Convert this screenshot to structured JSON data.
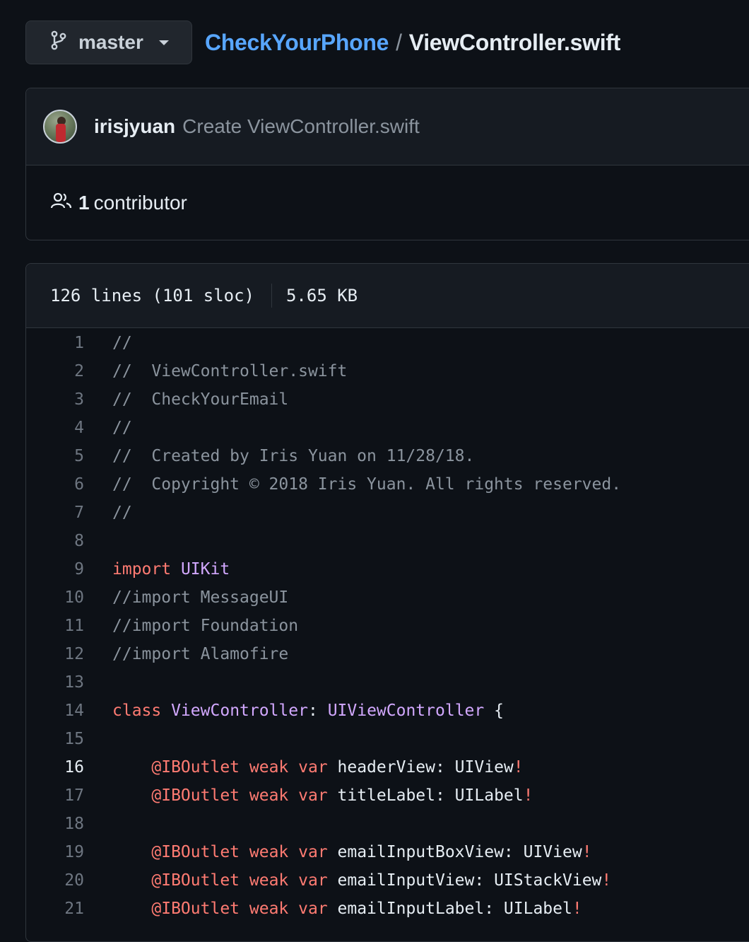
{
  "header": {
    "branch": "master",
    "repo": "CheckYourPhone",
    "separator": "/",
    "file": "ViewController.swift"
  },
  "commit": {
    "author": "irisjyuan",
    "message": "Create ViewController.swift",
    "contributor_count": "1",
    "contributor_label": "contributor"
  },
  "file_info": {
    "lines": "126 lines (101 sloc)",
    "size": "5.65 KB"
  },
  "icons": [
    "git-branch-icon",
    "caret-down-icon",
    "people-icon"
  ],
  "colors": {
    "background": "#0d1117",
    "panel": "#161b22",
    "border": "#30363d",
    "link": "#58a6ff",
    "keyword": "#ff7b72",
    "type": "#d2a8ff",
    "comment": "#8b949e"
  },
  "code": {
    "active_line": 16,
    "lines": [
      {
        "n": "1",
        "segs": [
          {
            "t": "//",
            "c": "cm"
          }
        ]
      },
      {
        "n": "2",
        "segs": [
          {
            "t": "//  ViewController.swift",
            "c": "cm"
          }
        ]
      },
      {
        "n": "3",
        "segs": [
          {
            "t": "//  CheckYourEmail",
            "c": "cm"
          }
        ]
      },
      {
        "n": "4",
        "segs": [
          {
            "t": "//",
            "c": "cm"
          }
        ]
      },
      {
        "n": "5",
        "segs": [
          {
            "t": "//  Created by Iris Yuan on 11/28/18.",
            "c": "cm"
          }
        ]
      },
      {
        "n": "6",
        "segs": [
          {
            "t": "//  Copyright © 2018 Iris Yuan. All rights reserved.",
            "c": "cm"
          }
        ]
      },
      {
        "n": "7",
        "segs": [
          {
            "t": "//",
            "c": "cm"
          }
        ]
      },
      {
        "n": "8",
        "segs": []
      },
      {
        "n": "9",
        "segs": [
          {
            "t": "import",
            "c": "kw"
          },
          {
            "t": " ",
            "c": ""
          },
          {
            "t": "UIKit",
            "c": "ty"
          }
        ]
      },
      {
        "n": "10",
        "segs": [
          {
            "t": "//import MessageUI",
            "c": "cm"
          }
        ]
      },
      {
        "n": "11",
        "segs": [
          {
            "t": "//import Foundation",
            "c": "cm"
          }
        ]
      },
      {
        "n": "12",
        "segs": [
          {
            "t": "//import Alamofire",
            "c": "cm"
          }
        ]
      },
      {
        "n": "13",
        "segs": []
      },
      {
        "n": "14",
        "segs": [
          {
            "t": "class",
            "c": "kw"
          },
          {
            "t": " ",
            "c": ""
          },
          {
            "t": "ViewController",
            "c": "ty"
          },
          {
            "t": ": ",
            "c": ""
          },
          {
            "t": "UIViewController",
            "c": "ty"
          },
          {
            "t": " {",
            "c": ""
          }
        ]
      },
      {
        "n": "15",
        "segs": []
      },
      {
        "n": "16",
        "segs": [
          {
            "t": "    ",
            "c": ""
          },
          {
            "t": "@IBOutlet",
            "c": "kw"
          },
          {
            "t": " ",
            "c": ""
          },
          {
            "t": "weak",
            "c": "kw"
          },
          {
            "t": " ",
            "c": ""
          },
          {
            "t": "var",
            "c": "kw"
          },
          {
            "t": " headerView: UIView",
            "c": ""
          },
          {
            "t": "!",
            "c": "kw"
          }
        ]
      },
      {
        "n": "17",
        "segs": [
          {
            "t": "    ",
            "c": ""
          },
          {
            "t": "@IBOutlet",
            "c": "kw"
          },
          {
            "t": " ",
            "c": ""
          },
          {
            "t": "weak",
            "c": "kw"
          },
          {
            "t": " ",
            "c": ""
          },
          {
            "t": "var",
            "c": "kw"
          },
          {
            "t": " titleLabel: UILabel",
            "c": ""
          },
          {
            "t": "!",
            "c": "kw"
          }
        ]
      },
      {
        "n": "18",
        "segs": []
      },
      {
        "n": "19",
        "segs": [
          {
            "t": "    ",
            "c": ""
          },
          {
            "t": "@IBOutlet",
            "c": "kw"
          },
          {
            "t": " ",
            "c": ""
          },
          {
            "t": "weak",
            "c": "kw"
          },
          {
            "t": " ",
            "c": ""
          },
          {
            "t": "var",
            "c": "kw"
          },
          {
            "t": " emailInputBoxView: UIView",
            "c": ""
          },
          {
            "t": "!",
            "c": "kw"
          }
        ]
      },
      {
        "n": "20",
        "segs": [
          {
            "t": "    ",
            "c": ""
          },
          {
            "t": "@IBOutlet",
            "c": "kw"
          },
          {
            "t": " ",
            "c": ""
          },
          {
            "t": "weak",
            "c": "kw"
          },
          {
            "t": " ",
            "c": ""
          },
          {
            "t": "var",
            "c": "kw"
          },
          {
            "t": " emailInputView: UIStackView",
            "c": ""
          },
          {
            "t": "!",
            "c": "kw"
          }
        ]
      },
      {
        "n": "21",
        "segs": [
          {
            "t": "    ",
            "c": ""
          },
          {
            "t": "@IBOutlet",
            "c": "kw"
          },
          {
            "t": " ",
            "c": ""
          },
          {
            "t": "weak",
            "c": "kw"
          },
          {
            "t": " ",
            "c": ""
          },
          {
            "t": "var",
            "c": "kw"
          },
          {
            "t": " emailInputLabel: UILabel",
            "c": ""
          },
          {
            "t": "!",
            "c": "kw"
          }
        ]
      }
    ]
  }
}
